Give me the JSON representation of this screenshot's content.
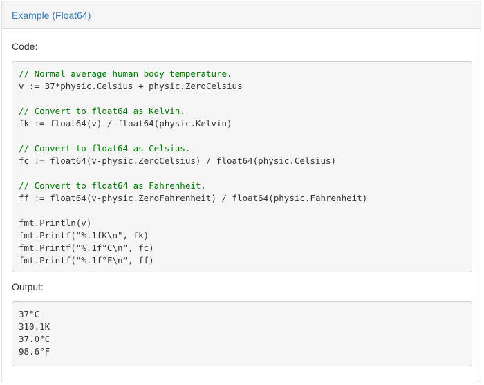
{
  "panel": {
    "title": "Example (Float64)"
  },
  "code_section": {
    "label": "Code:",
    "lines": [
      {
        "text": "// Normal average human body temperature.",
        "kind": "comment"
      },
      {
        "text": "v := 37*physic.Celsius + physic.ZeroCelsius",
        "kind": "code"
      },
      {
        "text": "",
        "kind": "blank"
      },
      {
        "text": "// Convert to float64 as Kelvin.",
        "kind": "comment"
      },
      {
        "text": "fk := float64(v) / float64(physic.Kelvin)",
        "kind": "code"
      },
      {
        "text": "",
        "kind": "blank"
      },
      {
        "text": "// Convert to float64 as Celsius.",
        "kind": "comment"
      },
      {
        "text": "fc := float64(v-physic.ZeroCelsius) / float64(physic.Celsius)",
        "kind": "code"
      },
      {
        "text": "",
        "kind": "blank"
      },
      {
        "text": "// Convert to float64 as Fahrenheit.",
        "kind": "comment"
      },
      {
        "text": "ff := float64(v-physic.ZeroFahrenheit) / float64(physic.Fahrenheit)",
        "kind": "code"
      },
      {
        "text": "",
        "kind": "blank"
      },
      {
        "text": "fmt.Println(v)",
        "kind": "code"
      },
      {
        "text": "fmt.Printf(\"%.1fK\\n\", fk)",
        "kind": "code"
      },
      {
        "text": "fmt.Printf(\"%.1f°C\\n\", fc)",
        "kind": "code"
      },
      {
        "text": "fmt.Printf(\"%.1f°F\\n\", ff)",
        "kind": "code"
      }
    ]
  },
  "output_section": {
    "label": "Output:",
    "lines": [
      {
        "text": "37°C"
      },
      {
        "text": "310.1K"
      },
      {
        "text": "37.0°C"
      },
      {
        "text": "98.6°F"
      }
    ]
  },
  "colors": {
    "link": "#337ab7",
    "comment": "#007a00",
    "code_background": "#f5f5f5",
    "border": "#dddddd"
  }
}
